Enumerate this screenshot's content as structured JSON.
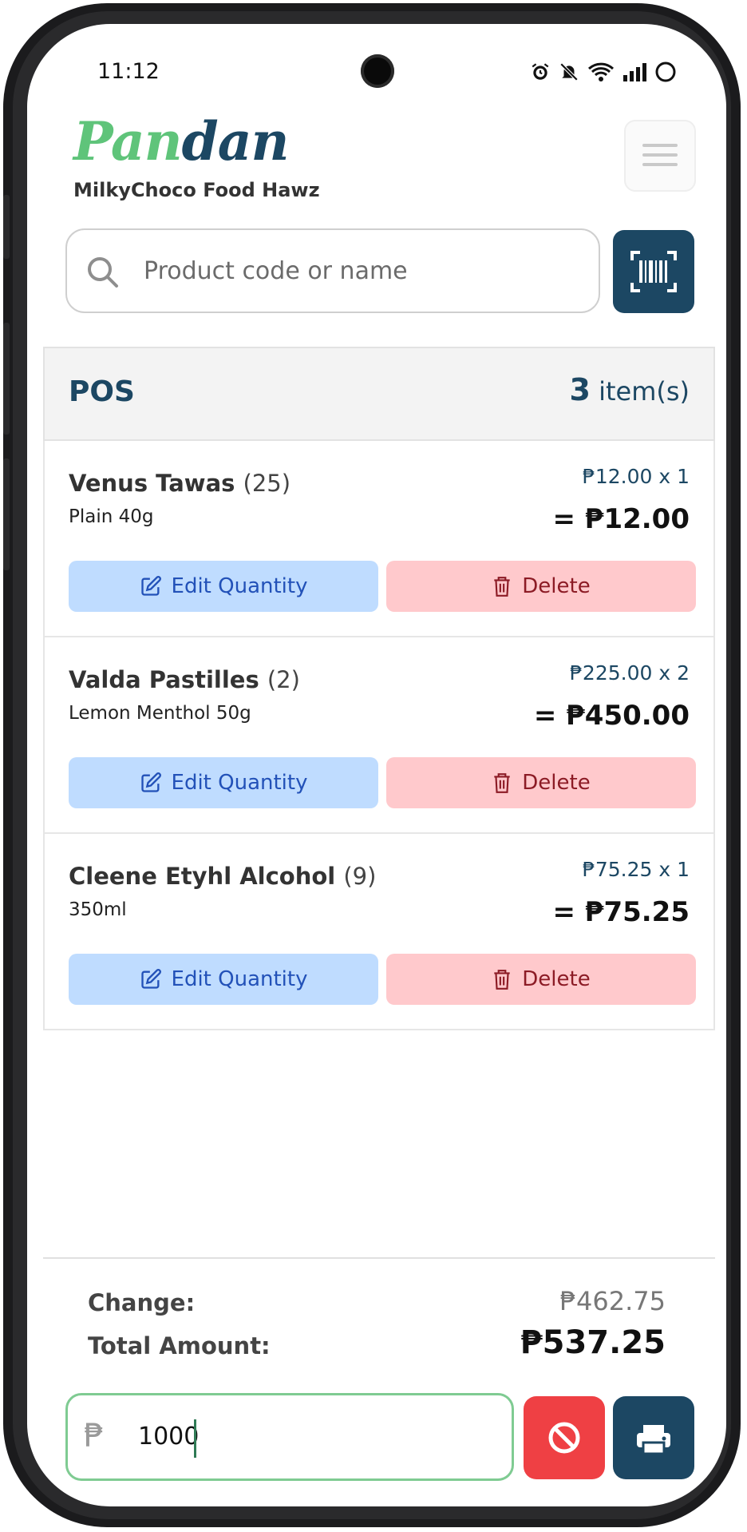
{
  "status_bar": {
    "time": "11:12",
    "icons": [
      "alarm-icon",
      "bell-off-icon",
      "wifi-icon",
      "signal-icon",
      "battery-icon"
    ]
  },
  "header": {
    "brand_part1": "Pan",
    "brand_part2": "dan",
    "store_name": "MilkyChoco Food Hawz"
  },
  "search": {
    "placeholder": "Product code or name"
  },
  "pos": {
    "title": "POS",
    "item_count": "3",
    "item_count_suffix": "item(s)"
  },
  "cart_items": [
    {
      "name": "Venus Tawas",
      "stock": "(25)",
      "description": "Plain 40g",
      "unit_price": "₱12.00 x 1",
      "subtotal": "= ₱12.00",
      "edit_label": "Edit Quantity",
      "delete_label": "Delete"
    },
    {
      "name": "Valda Pastilles",
      "stock": "(2)",
      "description": "Lemon Menthol 50g",
      "unit_price": "₱225.00 x 2",
      "subtotal": "= ₱450.00",
      "edit_label": "Edit Quantity",
      "delete_label": "Delete"
    },
    {
      "name": "Cleene Etyhl Alcohol",
      "stock": "(9)",
      "description": "350ml",
      "unit_price": "₱75.25 x 1",
      "subtotal": "= ₱75.25",
      "edit_label": "Edit Quantity",
      "delete_label": "Delete"
    }
  ],
  "summary": {
    "change_label": "Change:",
    "change_value": "₱462.75",
    "total_label": "Total Amount:",
    "total_value": "₱537.25"
  },
  "payment": {
    "currency_symbol": "₱",
    "amount": "1000"
  },
  "colors": {
    "brand_green": "#5fc47a",
    "brand_navy": "#1c4763",
    "edit_bg": "#bfdcff",
    "delete_bg": "#ffc9cc",
    "cancel_red": "#ef4044"
  }
}
